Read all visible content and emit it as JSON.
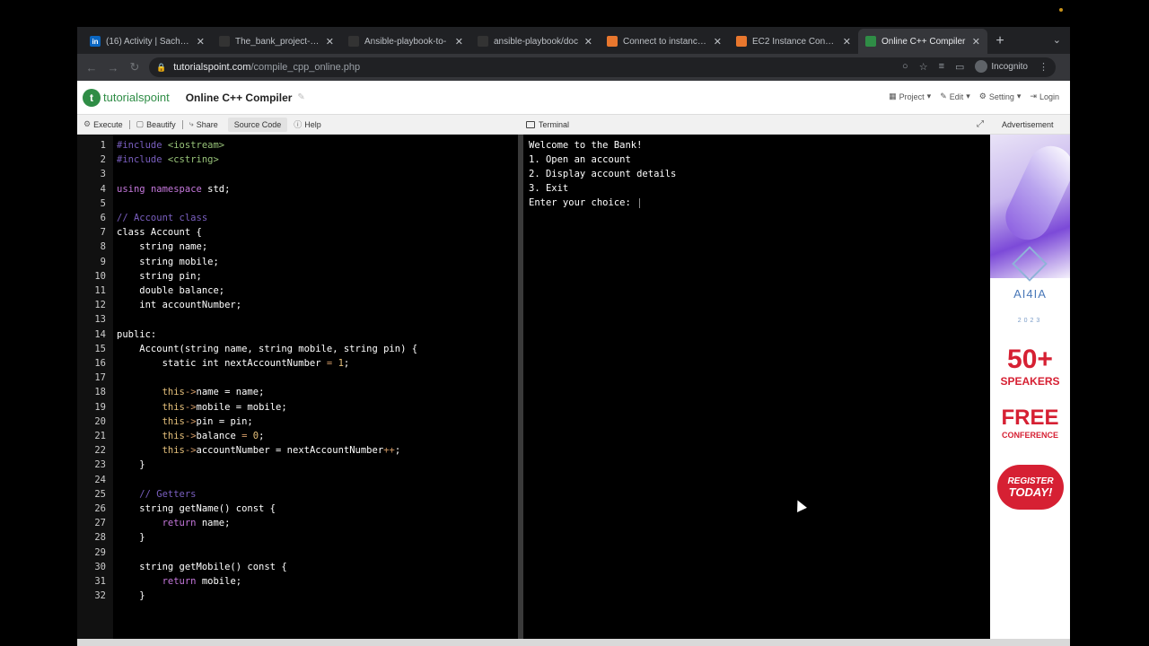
{
  "browser": {
    "tabs": [
      {
        "favicon": "linkedin-icon",
        "favicon_color": "#0a66c2",
        "favicon_text": "in",
        "title": "(16) Activity | Sachin S",
        "active": false
      },
      {
        "favicon": "github-icon",
        "favicon_color": "#333333",
        "favicon_text": "",
        "title": "The_bank_project-ma",
        "active": false
      },
      {
        "favicon": "github-icon",
        "favicon_color": "#333333",
        "favicon_text": "",
        "title": "Ansible-playbook-to-",
        "active": false
      },
      {
        "favicon": "github-icon",
        "favicon_color": "#333333",
        "favicon_text": "",
        "title": "ansible-playbook/doc",
        "active": false
      },
      {
        "favicon": "aws-icon",
        "favicon_color": "#e8772e",
        "favicon_text": "",
        "title": "Connect to instance | E",
        "active": false
      },
      {
        "favicon": "ec2-icon",
        "favicon_color": "#e8772e",
        "favicon_text": "",
        "title": "EC2 Instance Connect",
        "active": false
      },
      {
        "favicon": "code-icon",
        "favicon_color": "#2f8d46",
        "favicon_text": "",
        "title": "Online C++ Compiler",
        "active": true
      }
    ],
    "url_host": "tutorialspoint.com",
    "url_path": "/compile_cpp_online.php",
    "profile_label": "Incognito"
  },
  "site": {
    "logo_text": "tutorialspoint",
    "page_title": "Online C++ Compiler",
    "menu": {
      "project": "Project",
      "edit": "Edit",
      "setting": "Setting",
      "login": "Login"
    }
  },
  "toolbar": {
    "execute": "Execute",
    "beautify": "Beautify",
    "share": "Share",
    "source_code": "Source Code",
    "help": "Help",
    "terminal": "Terminal",
    "advertisement": "Advertisement"
  },
  "code_lines": [
    "#include <iostream>",
    "#include <cstring>",
    "",
    "using namespace std;",
    "",
    "// Account class",
    "class Account {",
    "    string name;",
    "    string mobile;",
    "    string pin;",
    "    double balance;",
    "    int accountNumber;",
    "",
    "public:",
    "    Account(string name, string mobile, string pin) {",
    "        static int nextAccountNumber = 1;",
    "",
    "        this->name = name;",
    "        this->mobile = mobile;",
    "        this->pin = pin;",
    "        this->balance = 0;",
    "        this->accountNumber = nextAccountNumber++;",
    "    }",
    "",
    "    // Getters",
    "    string getName() const {",
    "        return name;",
    "    }",
    "",
    "    string getMobile() const {",
    "        return mobile;",
    "    }"
  ],
  "terminal_lines": [
    "Welcome to the Bank!",
    "1. Open an account",
    "2. Display account details",
    "3. Exit",
    "Enter your choice: "
  ],
  "ad": {
    "brand": "AI4IA",
    "year": "2023",
    "speakers_num": "50+",
    "speakers_label": "SPEAKERS",
    "free": "FREE",
    "conference": "CONFERENCE",
    "register_line1": "REGISTER",
    "register_line2": "TODAY!"
  },
  "colors": {
    "accent": "#2f8d46",
    "ad_red": "#d62033"
  }
}
